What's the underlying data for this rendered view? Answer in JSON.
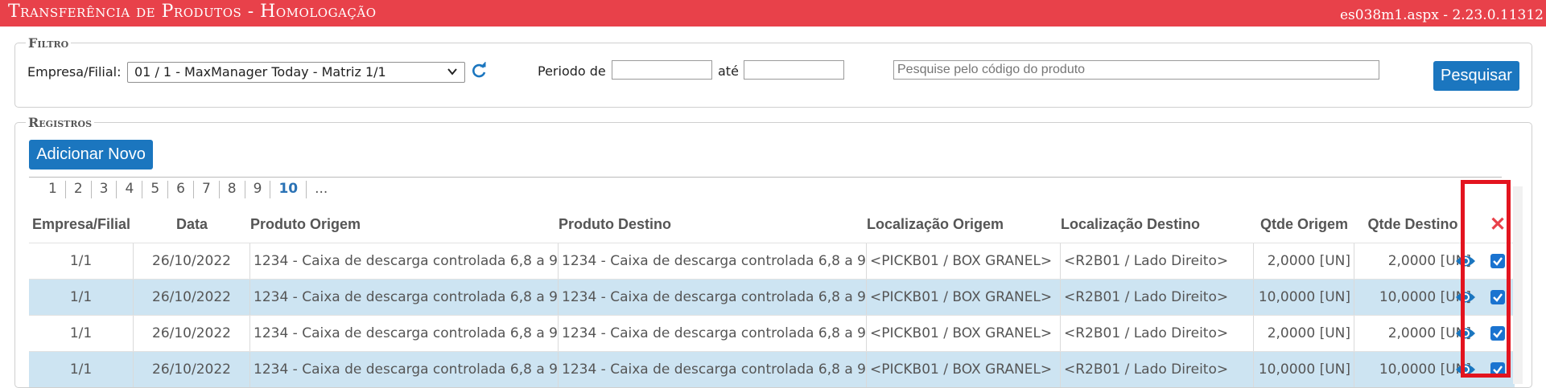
{
  "app": {
    "title": "Transferência de Produtos  - Homologação",
    "version": "es038m1.aspx - 2.23.0.11312"
  },
  "filter": {
    "legend": "Filtro",
    "company_label": "Empresa/Filial:",
    "company_value": "01 / 1 - MaxManager Today - Matriz 1/1",
    "period_from_label": "Periodo de",
    "period_from_value": "",
    "period_to_label": "até",
    "period_to_value": "",
    "search_placeholder": "Pesquise pelo código do produto",
    "search_button": "Pesquisar"
  },
  "records": {
    "legend": "Registros",
    "add_button": "Adicionar Novo",
    "pages": [
      "1",
      "2",
      "3",
      "4",
      "5",
      "6",
      "7",
      "8",
      "9",
      "10",
      "..."
    ],
    "current_page": "10",
    "columns": {
      "empresa": "Empresa/Filial",
      "data": "Data",
      "produto_origem": "Produto Origem",
      "produto_destino": "Produto Destino",
      "local_origem": "Localização Origem",
      "local_destino": "Localização Destino",
      "qtde_origem": "Qtde Origem",
      "qtde_destino": "Qtde Destino",
      "delete_all": "✕"
    },
    "rows": [
      {
        "empresa": "1/1",
        "data": "26/10/2022",
        "produto_origem": "1234 - Caixa de descarga controlada 6,8 a 9...",
        "produto_destino": "1234 - Caixa de descarga controlada 6,8 a 9...",
        "local_origem": "<PICKB01 / BOX GRANEL>",
        "local_destino": "<R2B01 / Lado Direito>",
        "qtde_origem": "2,0000 [UN]",
        "qtde_destino": "2,0000 [UN]",
        "checked": true
      },
      {
        "empresa": "1/1",
        "data": "26/10/2022",
        "produto_origem": "1234 - Caixa de descarga controlada 6,8 a 9...",
        "produto_destino": "1234 - Caixa de descarga controlada 6,8 a 9...",
        "local_origem": "<PICKB01 / BOX GRANEL>",
        "local_destino": "<R2B01 / Lado Direito>",
        "qtde_origem": "10,0000 [UN]",
        "qtde_destino": "10,0000 [UN]",
        "checked": true
      },
      {
        "empresa": "1/1",
        "data": "26/10/2022",
        "produto_origem": "1234 - Caixa de descarga controlada 6,8 a 9...",
        "produto_destino": "1234 - Caixa de descarga controlada 6,8 a 9...",
        "local_origem": "<PICKB01 / BOX GRANEL>",
        "local_destino": "<R2B01 / Lado Direito>",
        "qtde_origem": "2,0000 [UN]",
        "qtde_destino": "2,0000 [UN]",
        "checked": true
      },
      {
        "empresa": "1/1",
        "data": "26/10/2022",
        "produto_origem": "1234 - Caixa de descarga controlada 6,8 a 9...",
        "produto_destino": "1234 - Caixa de descarga controlada 6,8 a 9...",
        "local_origem": "<PICKB01 / BOX GRANEL>",
        "local_destino": "<R2B01 / Lado Direito>",
        "qtde_origem": "10,0000 [UN]",
        "qtde_destino": "10,0000 [UN]",
        "checked": true
      }
    ]
  },
  "colors": {
    "brand": "#e8414a",
    "button": "#1b76bf",
    "row_alt": "#cde4f2",
    "highlight": "#e3141f"
  },
  "icons": [
    "refresh-icon",
    "chevron-down-icon",
    "eye-icon",
    "close-icon",
    "checkbox-checked-icon"
  ]
}
